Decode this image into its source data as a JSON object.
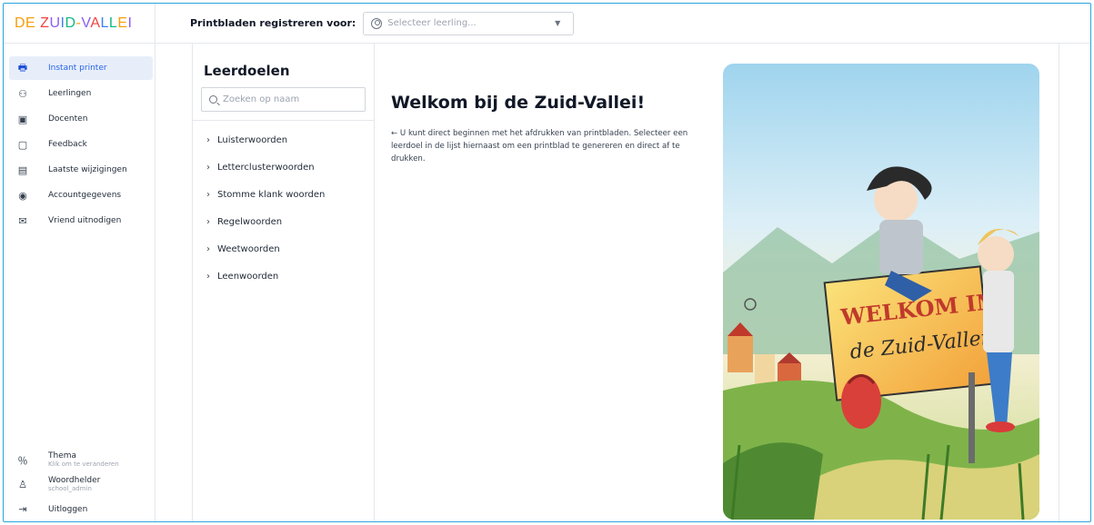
{
  "header": {
    "logo": "DE ZUID-VALLEI",
    "register_label": "Printbladen registreren voor:",
    "student_placeholder": "Selecteer leerling..."
  },
  "sidebar": {
    "items": [
      {
        "label": "Instant printer",
        "icon": "printer-icon"
      },
      {
        "label": "Leerlingen",
        "icon": "users-icon"
      },
      {
        "label": "Docenten",
        "icon": "teacher-icon"
      },
      {
        "label": "Feedback",
        "icon": "feedback-icon"
      },
      {
        "label": "Laatste wijzigingen",
        "icon": "changelog-icon"
      },
      {
        "label": "Accountgegevens",
        "icon": "account-icon"
      },
      {
        "label": "Vriend uitnodigen",
        "icon": "mail-icon"
      }
    ],
    "theme": {
      "title": "Thema",
      "subtitle": "Klik om te veranderen"
    },
    "user": {
      "name": "Woordhelder",
      "role": "school_admin"
    },
    "logout": "Uitloggen"
  },
  "goals": {
    "title": "Leerdoelen",
    "search_placeholder": "Zoeken op naam",
    "items": [
      "Luisterwoorden",
      "Letterclusterwoorden",
      "Stomme klank woorden",
      "Regelwoorden",
      "Weetwoorden",
      "Leenwoorden"
    ]
  },
  "welcome": {
    "title": "Welkom bij de Zuid-Vallei!",
    "body": "← U kunt direct beginnen met het afdrukken van printbladen. Selecteer een leerdoel in de lijst hiernaast om een printblad te genereren en direct af te drukken."
  },
  "illustration": {
    "sign_line1": "WELKOM IN",
    "sign_line2": "de Zuid-Vallei"
  },
  "colors": {
    "accent": "#2563eb",
    "active_bg": "#e8eef9",
    "frame": "#2aa6dd"
  }
}
